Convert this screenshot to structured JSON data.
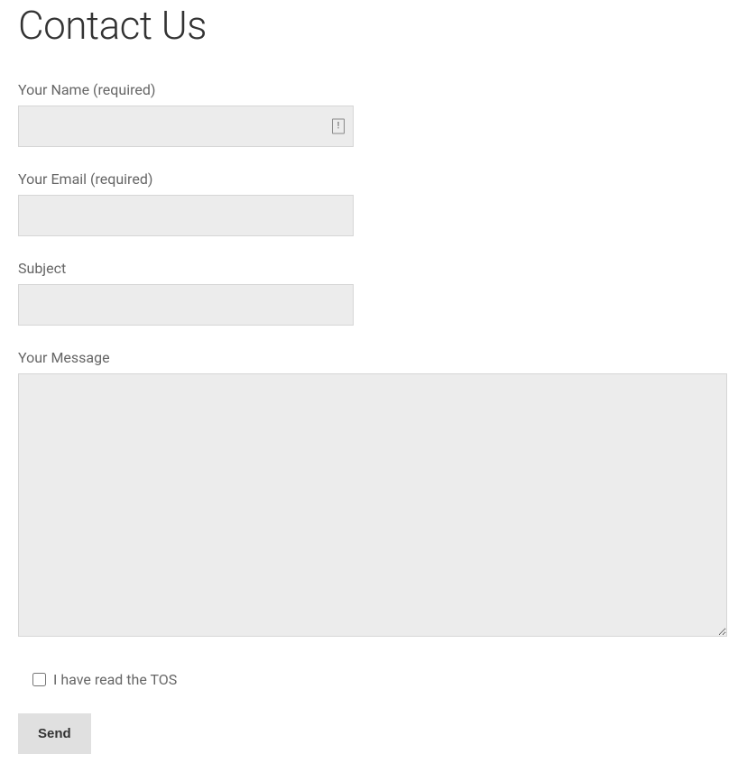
{
  "page": {
    "title": "Contact Us"
  },
  "form": {
    "name": {
      "label": "Your Name (required)",
      "value": ""
    },
    "email": {
      "label": "Your Email (required)",
      "value": ""
    },
    "subject": {
      "label": "Subject",
      "value": ""
    },
    "message": {
      "label": "Your Message",
      "value": ""
    },
    "tos": {
      "label": "I have read the TOS",
      "checked": false
    },
    "submit": {
      "label": "Send"
    }
  }
}
